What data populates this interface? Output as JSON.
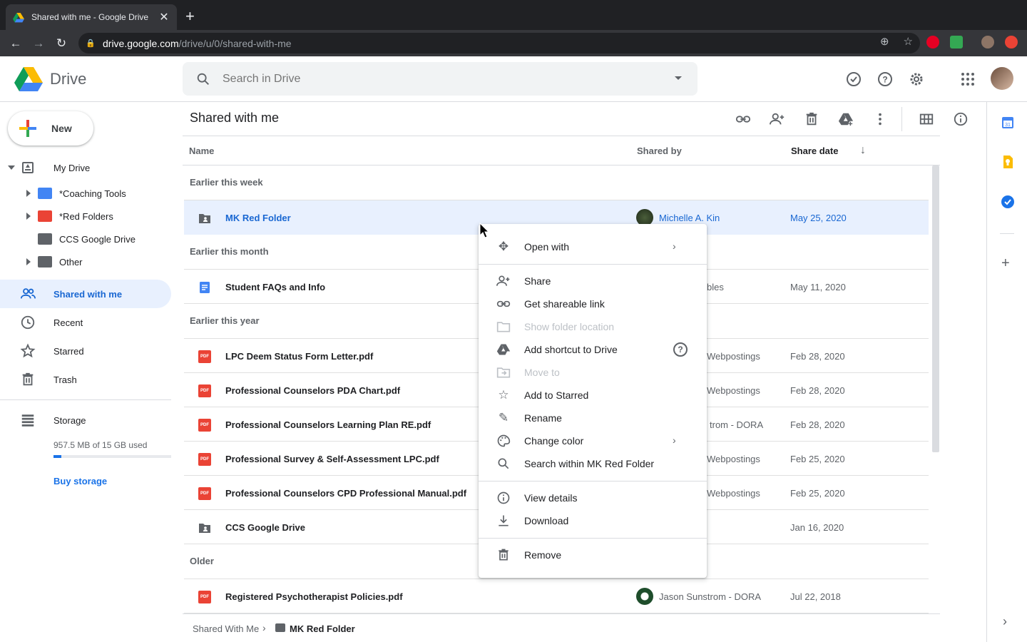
{
  "browser": {
    "tab_title": "Shared with me - Google Drive",
    "url_host": "drive.google.com",
    "url_path": "/drive/u/0/shared-with-me"
  },
  "header": {
    "app_name": "Drive",
    "search_placeholder": "Search in Drive"
  },
  "sidebar": {
    "new_label": "New",
    "my_drive": "My Drive",
    "tree": [
      {
        "label": "*Coaching Tools",
        "color": "#4285f4"
      },
      {
        "label": "*Red Folders",
        "color": "#ea4335"
      },
      {
        "label": "CCS Google Drive",
        "color": "#5f6368"
      },
      {
        "label": "Other",
        "color": "#5f6368"
      }
    ],
    "shared_with_me": "Shared with me",
    "recent": "Recent",
    "starred": "Starred",
    "trash": "Trash",
    "storage": "Storage",
    "storage_used": "957.5 MB of 15 GB used",
    "storage_fraction": 0.064,
    "buy_storage": "Buy storage"
  },
  "main": {
    "title": "Shared with me",
    "columns": {
      "name": "Name",
      "shared_by": "Shared by",
      "share_date": "Share date"
    },
    "sections": {
      "week": "Earlier this week",
      "month": "Earlier this month",
      "year": "Earlier this year",
      "older": "Older"
    },
    "rows": [
      {
        "name": "MK Red Folder",
        "shared_by": "Michelle A. Kin",
        "date": "May 25, 2020",
        "type": "shared-folder"
      },
      {
        "name": "Student FAQs and Info",
        "shared_by": "bles",
        "date": "May 11, 2020",
        "type": "doc"
      },
      {
        "name": "LPC Deem Status Form Letter.pdf",
        "shared_by": "Webpostings",
        "date": "Feb 28, 2020",
        "type": "pdf"
      },
      {
        "name": "Professional Counselors PDA Chart.pdf",
        "shared_by": "Webpostings",
        "date": "Feb 28, 2020",
        "type": "pdf"
      },
      {
        "name": "Professional Counselors Learning Plan RE.pdf",
        "shared_by": "trom - DORA",
        "date": "Feb 28, 2020",
        "type": "pdf"
      },
      {
        "name": "Professional Survey & Self-Assessment LPC.pdf",
        "shared_by": "Webpostings",
        "date": "Feb 25, 2020",
        "type": "pdf"
      },
      {
        "name": "Professional Counselors CPD Professional Manual.pdf",
        "shared_by": "Webpostings",
        "date": "Feb 25, 2020",
        "type": "pdf"
      },
      {
        "name": "CCS Google Drive",
        "shared_by": "",
        "date": "Jan 16, 2020",
        "type": "shared-folder"
      },
      {
        "name": "Registered Psychotherapist Policies.pdf",
        "shared_by": "Jason Sunstrom - DORA",
        "date": "Jul 22, 2018",
        "type": "pdf"
      }
    ]
  },
  "breadcrumb": {
    "root": "Shared With Me",
    "current": "MK Red Folder"
  },
  "context_menu": {
    "open_with": "Open with",
    "share": "Share",
    "get_link": "Get shareable link",
    "show_location": "Show folder location",
    "add_shortcut": "Add shortcut to Drive",
    "move_to": "Move to",
    "add_starred": "Add to Starred",
    "rename": "Rename",
    "change_color": "Change color",
    "search_within": "Search within MK Red Folder",
    "view_details": "View details",
    "download": "Download",
    "remove": "Remove"
  },
  "colors": {
    "accent": "#1a73e8",
    "selected_bg": "#e8f0fe",
    "pdf_red": "#ea4335"
  }
}
